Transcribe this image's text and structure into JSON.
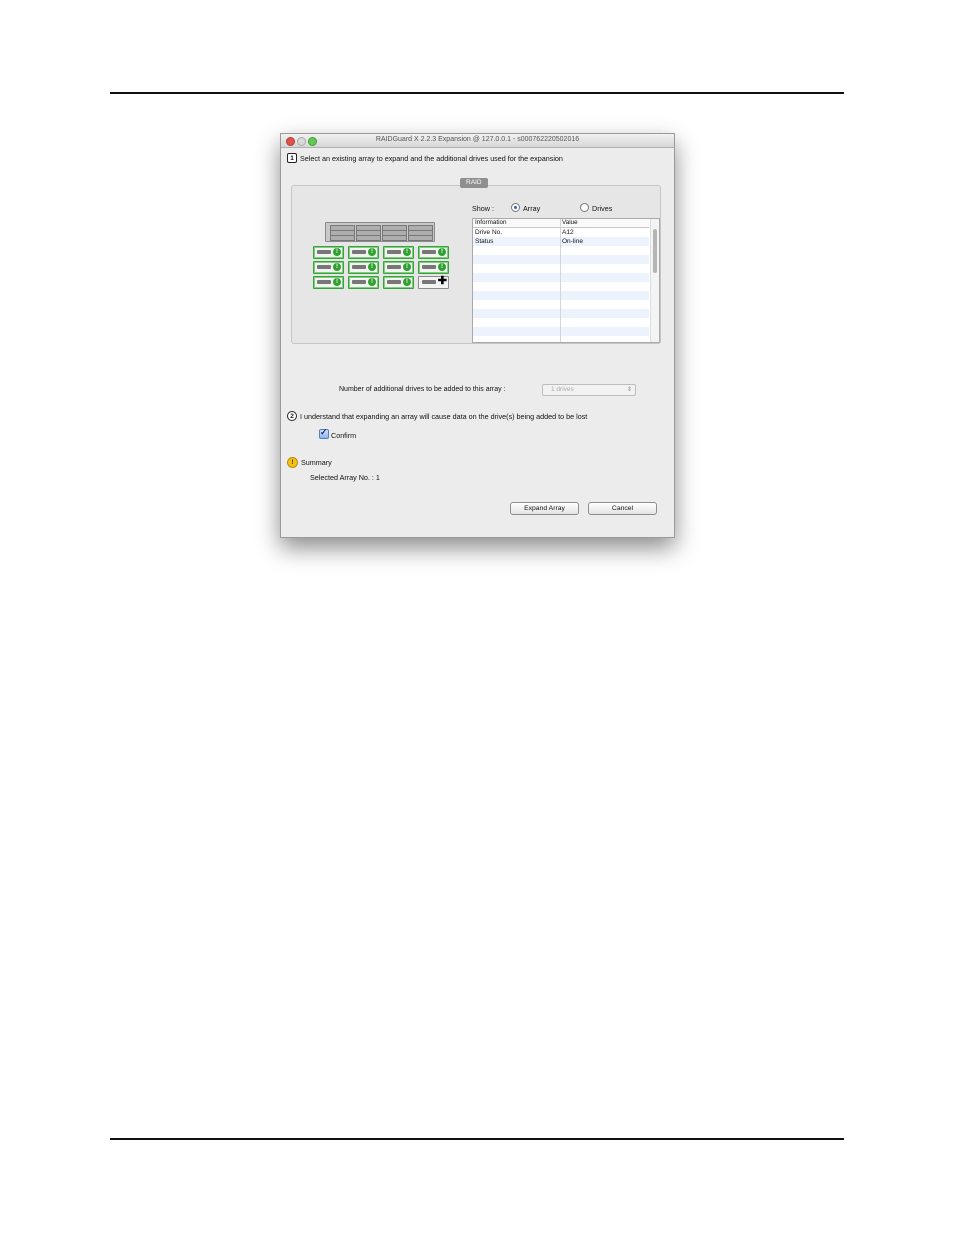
{
  "window": {
    "title": "RAIDGuard X 2.2.3 Expansion @ 127.0.0.1 - s000762220502016"
  },
  "step1": {
    "number": "1",
    "text": "Select an existing array to expand and the additional drives used for the expansion"
  },
  "raid_tab": "RAID",
  "show": {
    "label": "Show :",
    "options": [
      "Array",
      "Drives"
    ],
    "selected": "Array"
  },
  "info_table": {
    "headers": [
      "Information",
      "Value"
    ],
    "rows": [
      [
        "Drive No.",
        "A12"
      ],
      [
        "Status",
        "On-line"
      ]
    ]
  },
  "drive_grid": [
    {
      "status": "active",
      "badge": "!"
    },
    {
      "status": "active",
      "badge": "!"
    },
    {
      "status": "active",
      "badge": "!"
    },
    {
      "status": "active",
      "badge": "!"
    },
    {
      "status": "active",
      "badge": "!"
    },
    {
      "status": "active",
      "badge": "!"
    },
    {
      "status": "active",
      "badge": "!"
    },
    {
      "status": "active",
      "badge": "!"
    },
    {
      "status": "active",
      "badge": "!"
    },
    {
      "status": "active",
      "badge": "!"
    },
    {
      "status": "active",
      "badge": "!"
    },
    {
      "status": "add",
      "badge": "✚"
    }
  ],
  "additional_drives": {
    "label": "Number of additional drives to be added to this array :",
    "value": "1 drives"
  },
  "step2": {
    "number": "2",
    "text": "I understand that expanding an array will cause data on the drive(s) being added to be lost",
    "confirm_label": "Confirm",
    "confirm_checked": true
  },
  "summary": {
    "icon": "warning-icon",
    "title": "Summary",
    "detail": "Selected Array No. : 1"
  },
  "buttons": {
    "expand": "Expand Array",
    "cancel": "Cancel"
  },
  "colors": {
    "drive_active": "#2fa12f",
    "radio_selected": "#2a61c9",
    "warning": "#f3c21a"
  }
}
